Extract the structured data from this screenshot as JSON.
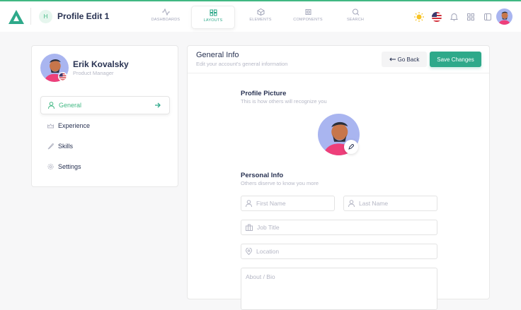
{
  "header": {
    "title": "Profile Edit 1",
    "badge": "H"
  },
  "nav": [
    {
      "label": "DASHBOARDS"
    },
    {
      "label": "LAYOUTS"
    },
    {
      "label": "ELEMENTS"
    },
    {
      "label": "COMPONENTS"
    },
    {
      "label": "SEARCH"
    }
  ],
  "profile": {
    "name": "Erik Kovalsky",
    "role": "Product Manager"
  },
  "menu": [
    {
      "label": "General"
    },
    {
      "label": "Experience"
    },
    {
      "label": "Skills"
    },
    {
      "label": "Settings"
    }
  ],
  "main": {
    "title": "General Info",
    "subtitle": "Edit your account's general information",
    "back": "Go Back",
    "save": "Save Changes",
    "picture_title": "Profile Picture",
    "picture_sub": "This is how others will recognize you",
    "personal_title": "Personal Info",
    "personal_sub": "Others diserve to know you more",
    "fields": {
      "first": "First Name",
      "last": "Last Name",
      "job": "Job Title",
      "location": "Location",
      "bio": "About / Bio"
    }
  },
  "colors": {
    "accent": "#41b883",
    "save": "#2ea98a"
  }
}
